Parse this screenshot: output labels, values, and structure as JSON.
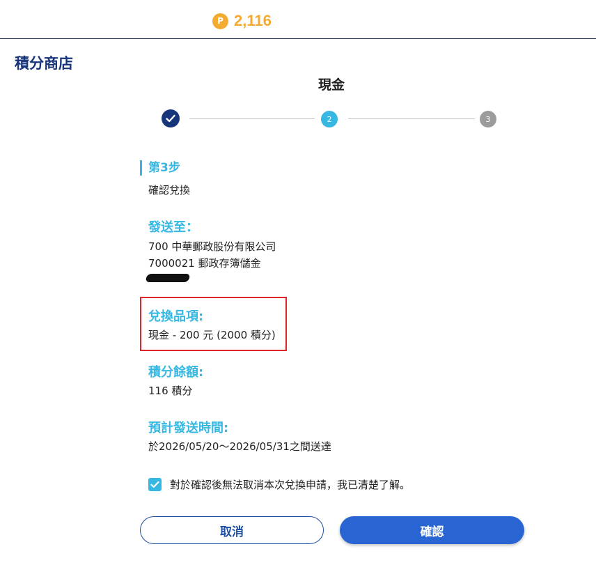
{
  "header": {
    "points_badge": "P",
    "points_value": "2,116"
  },
  "store_title": "積分商店",
  "page_title": "現金",
  "stepper": {
    "step2": "2",
    "step3": "3"
  },
  "step": {
    "label": "第3步",
    "description": "確認兌換"
  },
  "ship_to": {
    "title": "發送至：",
    "line1": "700 中華郵政股份有限公司",
    "line2": "7000021 郵政存簿儲金"
  },
  "item": {
    "title": "兌換品項:",
    "value": "現金 - 200 元 (2000 積分)"
  },
  "balance": {
    "title": "積分餘額:",
    "value": "116 積分"
  },
  "delivery": {
    "title": "預計發送時間:",
    "value": "於2026/05/20～2026/05/31之間送達"
  },
  "agreement": {
    "checked": true,
    "text": "對於確認後無法取消本次兌換申請，我已清楚了解。"
  },
  "buttons": {
    "cancel": "取消",
    "confirm": "確認"
  },
  "colors": {
    "brand_navy": "#17357a",
    "accent_cyan": "#36b8e3",
    "points_gold": "#f4ab32",
    "confirm_blue": "#2864d2",
    "highlight_red": "#e0262b"
  }
}
